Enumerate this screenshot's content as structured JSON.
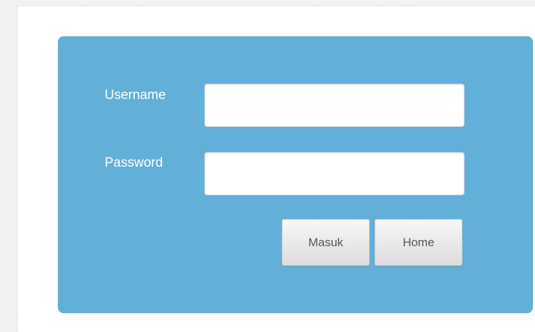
{
  "login_form": {
    "username_label": "Username",
    "password_label": "Password",
    "username_value": "",
    "password_value": "",
    "submit_label": "Masuk",
    "home_label": "Home"
  },
  "colors": {
    "panel_background": "#62b0d7",
    "label_text": "#ffffff",
    "button_text": "#555555"
  }
}
